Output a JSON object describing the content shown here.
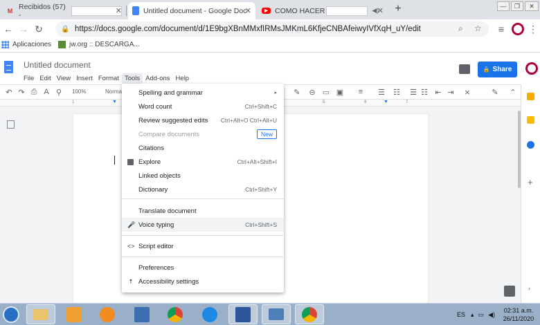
{
  "browser": {
    "tabs": [
      {
        "title": "Recibidos (57) -",
        "favicon": "gmail-icon",
        "favicon_color": "#d93025",
        "active": false
      },
      {
        "title": "Untitled document - Google Doc",
        "favicon": "docs-icon",
        "favicon_color": "#4285f4",
        "active": true
      },
      {
        "title": "COMO HACER",
        "favicon": "youtube-icon",
        "favicon_color": "#ff0000",
        "active": false
      }
    ],
    "url": "https://docs.google.com/document/d/1E9bgXBnMMxfIRMsJMKmL6KfjeCNBAfeiwyIVfXqH_uY/edit",
    "bookmarks": [
      {
        "label": "Aplicaciones",
        "icon": "apps-grid-icon"
      },
      {
        "label": "jw.org :: DESCARGA...",
        "icon": "jw-bookmark-icon"
      }
    ]
  },
  "docs": {
    "title": "Untitled document",
    "menu": [
      "File",
      "Edit",
      "View",
      "Insert",
      "Format",
      "Tools",
      "Add-ons",
      "Help"
    ],
    "share_label": "Share",
    "toolbar": {
      "zoom": "100%",
      "style": "Norma"
    },
    "ruler_ticks": [
      "1",
      "5",
      "6",
      "7"
    ]
  },
  "tools_menu": {
    "items": [
      {
        "label": "Spelling and grammar",
        "shortcut": "",
        "icon": "",
        "submenu": true
      },
      {
        "label": "Word count",
        "shortcut": "Ctrl+Shift+C"
      },
      {
        "label": "Review suggested edits",
        "shortcut": "Ctrl+Alt+O Ctrl+Alt+U"
      },
      {
        "label": "Compare documents",
        "badge": "New",
        "disabled": true
      },
      {
        "label": "Citations",
        "shortcut": ""
      },
      {
        "label": "Explore",
        "shortcut": "Ctrl+Alt+Shift+I",
        "icon": "explore-icon"
      },
      {
        "label": "Linked objects",
        "shortcut": ""
      },
      {
        "label": "Dictionary",
        "shortcut": "Ctrl+Shift+Y"
      },
      {
        "label": "Translate document",
        "shortcut": ""
      },
      {
        "label": "Voice typing",
        "shortcut": "Ctrl+Shift+S",
        "icon": "microphone-icon",
        "highlighted": true
      },
      {
        "label": "Script editor",
        "shortcut": "",
        "icon": "code-icon"
      },
      {
        "label": "Preferences",
        "shortcut": ""
      },
      {
        "label": "Accessibility settings",
        "shortcut": "",
        "icon": "accessibility-icon"
      }
    ]
  },
  "taskbar": {
    "lang": "ES",
    "time": "02:31 a.m.",
    "date": "26/11/2020"
  },
  "colors": {
    "accent": "#1a73e8",
    "taskbar": "#9ab0c8"
  }
}
